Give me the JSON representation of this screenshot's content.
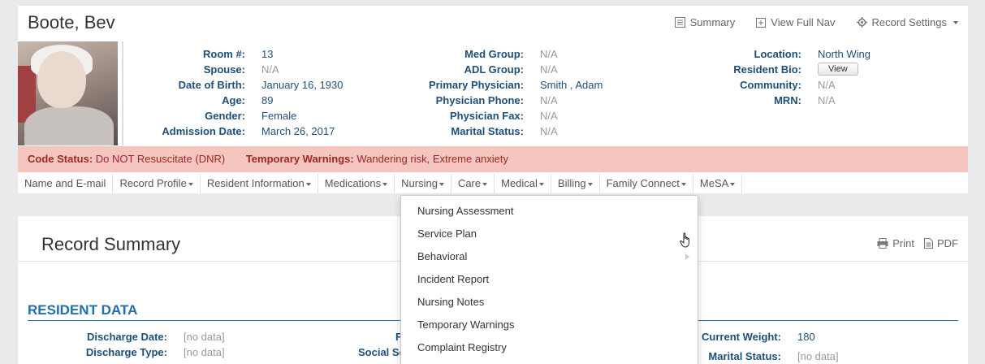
{
  "resident": {
    "name": "Boote, Bev"
  },
  "top_actions": {
    "summary": "Summary",
    "view_full_nav": "View Full Nav",
    "record_settings": "Record Settings"
  },
  "info": {
    "col1": [
      {
        "label": "Room #:",
        "value": "13"
      },
      {
        "label": "Spouse:",
        "value": "N/A"
      },
      {
        "label": "Date of Birth:",
        "value": "January 16, 1930"
      },
      {
        "label": "Age:",
        "value": "89"
      },
      {
        "label": "Gender:",
        "value": "Female"
      },
      {
        "label": "Admission Date:",
        "value": "March 26, 2017"
      }
    ],
    "col2": [
      {
        "label": "Med Group:",
        "value": "N/A"
      },
      {
        "label": "ADL Group:",
        "value": "N/A"
      },
      {
        "label": "Primary Physician:",
        "value": "Smith , Adam"
      },
      {
        "label": "Physician Phone:",
        "value": "N/A"
      },
      {
        "label": "Physician Fax:",
        "value": "N/A"
      },
      {
        "label": "Marital Status:",
        "value": "N/A"
      }
    ],
    "col3": [
      {
        "label": "Location:",
        "value": "North Wing"
      },
      {
        "label": "Resident Bio:",
        "value": "View"
      },
      {
        "label": "Community:",
        "value": "N/A"
      },
      {
        "label": "MRN:",
        "value": "N/A"
      }
    ]
  },
  "alerts": {
    "code_status_label": "Code Status:",
    "code_status_value": "Do NOT Resuscitate (DNR)",
    "warnings_label": "Temporary Warnings:",
    "warnings_value": "Wandering risk, Extreme anxiety"
  },
  "nav": {
    "items": [
      {
        "label": "Name and E-mail",
        "caret": false
      },
      {
        "label": "Record Profile",
        "caret": true
      },
      {
        "label": "Resident Information",
        "caret": true
      },
      {
        "label": "Medications",
        "caret": true
      },
      {
        "label": "Nursing",
        "caret": true
      },
      {
        "label": "Care",
        "caret": true
      },
      {
        "label": "Medical",
        "caret": true
      },
      {
        "label": "Billing",
        "caret": true
      },
      {
        "label": "Family Connect",
        "caret": true
      },
      {
        "label": "MeSA",
        "caret": true
      }
    ]
  },
  "dropdown": {
    "items": [
      {
        "label": "Nursing Assessment",
        "submenu": false
      },
      {
        "label": "Service Plan",
        "submenu": false
      },
      {
        "label": "Behavioral",
        "submenu": true
      },
      {
        "label": "Incident Report",
        "submenu": false
      },
      {
        "label": "Nursing Notes",
        "submenu": false
      },
      {
        "label": "Temporary Warnings",
        "submenu": false
      },
      {
        "label": "Complaint Registry",
        "submenu": false
      }
    ]
  },
  "summary": {
    "title": "Record Summary",
    "print": "Print",
    "pdf": "PDF",
    "section_heading": "RESIDENT DATA",
    "discharge_date_label": "Discharge Date:",
    "discharge_date_value": "[no data]",
    "discharge_type_label": "Discharge Type:",
    "discharge_type_value": "[no data]",
    "partial_f_label": "F",
    "partial_social_label": "Social Se",
    "current_weight_label": "Current Weight:",
    "current_weight_value": "180",
    "marital_status_label": "Marital Status:",
    "marital_status_value": "[no data]"
  },
  "colors": {
    "label_blue": "#1d4f7c",
    "heading_blue": "#1f6fb2",
    "alert_bg": "#f5c5c0",
    "alert_text": "#a02727"
  }
}
